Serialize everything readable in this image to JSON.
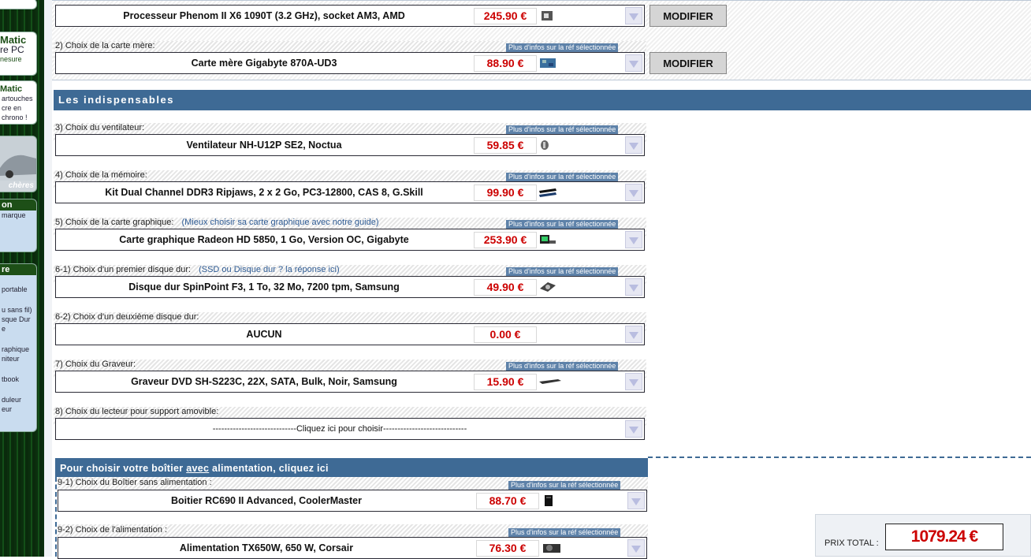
{
  "sidebar": {
    "box1": {
      "title": "Matic",
      "line1": "re PC",
      "line2": "nesure"
    },
    "box2": {
      "title": "Matic",
      "lines": [
        "artouches",
        "cre en",
        "chrono !"
      ]
    },
    "box3": {
      "caption": "chères"
    },
    "box4": {
      "title": "on",
      "lines": [
        "marque"
      ]
    },
    "box5": {
      "title": "re",
      "lines": [
        "portable",
        "u sans fil)",
        "sque Dur",
        "e",
        "raphique",
        "niteur",
        "tbook",
        "duleur",
        "eur"
      ]
    }
  },
  "top_rows": [
    {
      "label": "",
      "product": "Processeur Phenom II X6 1090T (3.2 GHz), socket AM3, AMD",
      "price": "245.90 €",
      "button": "MODIFIER",
      "thumb": "cpu-icon"
    },
    {
      "label": "2) Choix de la carte mère:",
      "info": "Plus d'infos sur la réf sélectionnée",
      "product": "Carte mère Gigabyte 870A-UD3",
      "price": "88.90 €",
      "button": "MODIFIER",
      "thumb": "motherboard-icon"
    }
  ],
  "section_title": "Les indispensables",
  "rows": [
    {
      "label": "3) Choix du ventilateur:",
      "info": "Plus d'infos sur la réf sélectionnée",
      "product": "Ventilateur NH-U12P SE2, Noctua",
      "price": "59.85 €",
      "thumb": "fan-icon"
    },
    {
      "label": "4) Choix de la mémoire:",
      "info": "Plus d'infos sur la réf sélectionnée",
      "product": "Kit Dual Channel DDR3 Ripjaws, 2 x 2 Go, PC3-12800, CAS 8, G.Skill",
      "price": "99.90 €",
      "thumb": "memory-icon"
    },
    {
      "label": "5) Choix de la carte graphique:",
      "link": "(Mieux choisir sa carte graphique avec notre guide)",
      "info": "Plus d'infos sur la réf sélectionnée",
      "product": "Carte graphique Radeon HD 5850, 1 Go, Version OC, Gigabyte",
      "price": "253.90 €",
      "thumb": "graphics-card-icon"
    },
    {
      "label": "6-1) Choix d'un premier disque dur:",
      "link": "(SSD ou Disque dur ? la réponse ici)",
      "info": "Plus d'infos sur la réf sélectionnée",
      "product": "Disque dur SpinPoint F3, 1 To, 32 Mo, 7200 tpm, Samsung",
      "price": "49.90 €",
      "thumb": "hard-drive-icon"
    },
    {
      "label": "6-2) Choix d'un deuxième disque dur:",
      "product": "AUCUN",
      "price": "0.00 €"
    },
    {
      "label": "7) Choix du Graveur:",
      "info": "Plus d'infos sur la réf sélectionnée",
      "product": "Graveur DVD SH-S223C, 22X, SATA, Bulk, Noir, Samsung",
      "price": "15.90 €",
      "thumb": "dvd-drive-icon"
    },
    {
      "label": "8) Choix du lecteur pour support amovible:",
      "product": "-----------------------------Cliquez ici pour choisir-----------------------------"
    }
  ],
  "case_section": {
    "header_pre": "Pour choisir votre boîtier ",
    "header_u": "avec",
    "header_post": " alimentation, cliquez ici",
    "rows": [
      {
        "label": "9-1) Choix du Boîtier sans alimentation :",
        "info": "Plus d'infos sur la réf sélectionnée",
        "product": "Boitier RC690 II Advanced, CoolerMaster",
        "price": "88.70 €",
        "thumb": "pc-case-icon"
      },
      {
        "label": "9-2) Choix de l'alimentation :",
        "info": "Plus d'infos sur la réf sélectionnée",
        "product": "Alimentation TX650W, 650 W, Corsair",
        "price": "76.30 €",
        "thumb": "power-supply-icon"
      }
    ]
  },
  "total": {
    "label": "PRIX TOTAL :",
    "value": "1079.24 €"
  }
}
